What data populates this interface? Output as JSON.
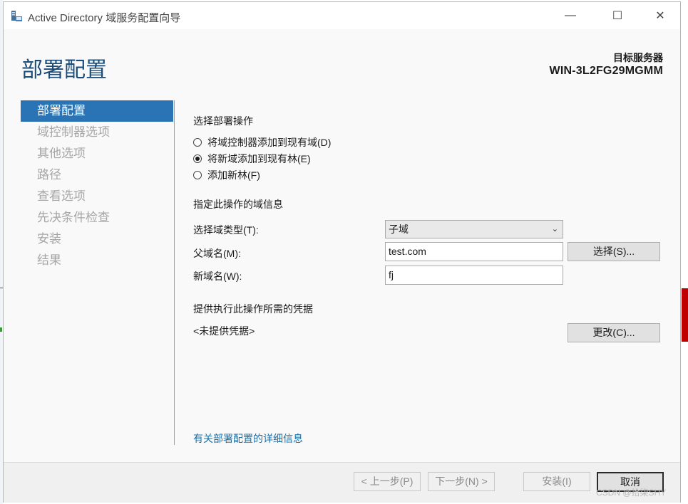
{
  "window": {
    "title": "Active Directory 域服务配置向导",
    "minimize_glyph": "—",
    "maximize_glyph": "☐",
    "close_glyph": "✕"
  },
  "header": {
    "page_title": "部署配置",
    "target_label": "目标服务器",
    "target_name": "WIN-3L2FG29MGMM"
  },
  "nav": {
    "items": [
      {
        "label": "部署配置",
        "active": true
      },
      {
        "label": "域控制器选项",
        "active": false
      },
      {
        "label": "其他选项",
        "active": false
      },
      {
        "label": "路径",
        "active": false
      },
      {
        "label": "查看选项",
        "active": false
      },
      {
        "label": "先决条件检查",
        "active": false
      },
      {
        "label": "安装",
        "active": false
      },
      {
        "label": "结果",
        "active": false
      }
    ]
  },
  "main": {
    "operation_heading": "选择部署操作",
    "radios": [
      {
        "label": "将域控制器添加到现有域(D)",
        "checked": false
      },
      {
        "label": "将新域添加到现有林(E)",
        "checked": true
      },
      {
        "label": "添加新林(F)",
        "checked": false
      }
    ],
    "domain_info_heading": "指定此操作的域信息",
    "domain_type_label": "选择域类型(T):",
    "domain_type_value": "子域",
    "parent_domain_label": "父域名(M):",
    "parent_domain_value": "test.com",
    "select_button": "选择(S)...",
    "new_domain_label": "新域名(W):",
    "new_domain_value": "fj",
    "credentials_heading": "提供执行此操作所需的凭据",
    "credentials_value": "<未提供凭据>",
    "change_button": "更改(C)...",
    "more_info_link": "有关部署配置的详细信息"
  },
  "footer": {
    "prev_button": "< 上一步(P)",
    "next_button": "下一步(N) >",
    "install_button": "安装(I)",
    "cancel_button": "取消"
  },
  "watermark": "CSDN @拾柒SHY",
  "colors": {
    "accent": "#2a74b5",
    "title_blue": "#1a4c7a",
    "link": "#1a6fa8"
  }
}
